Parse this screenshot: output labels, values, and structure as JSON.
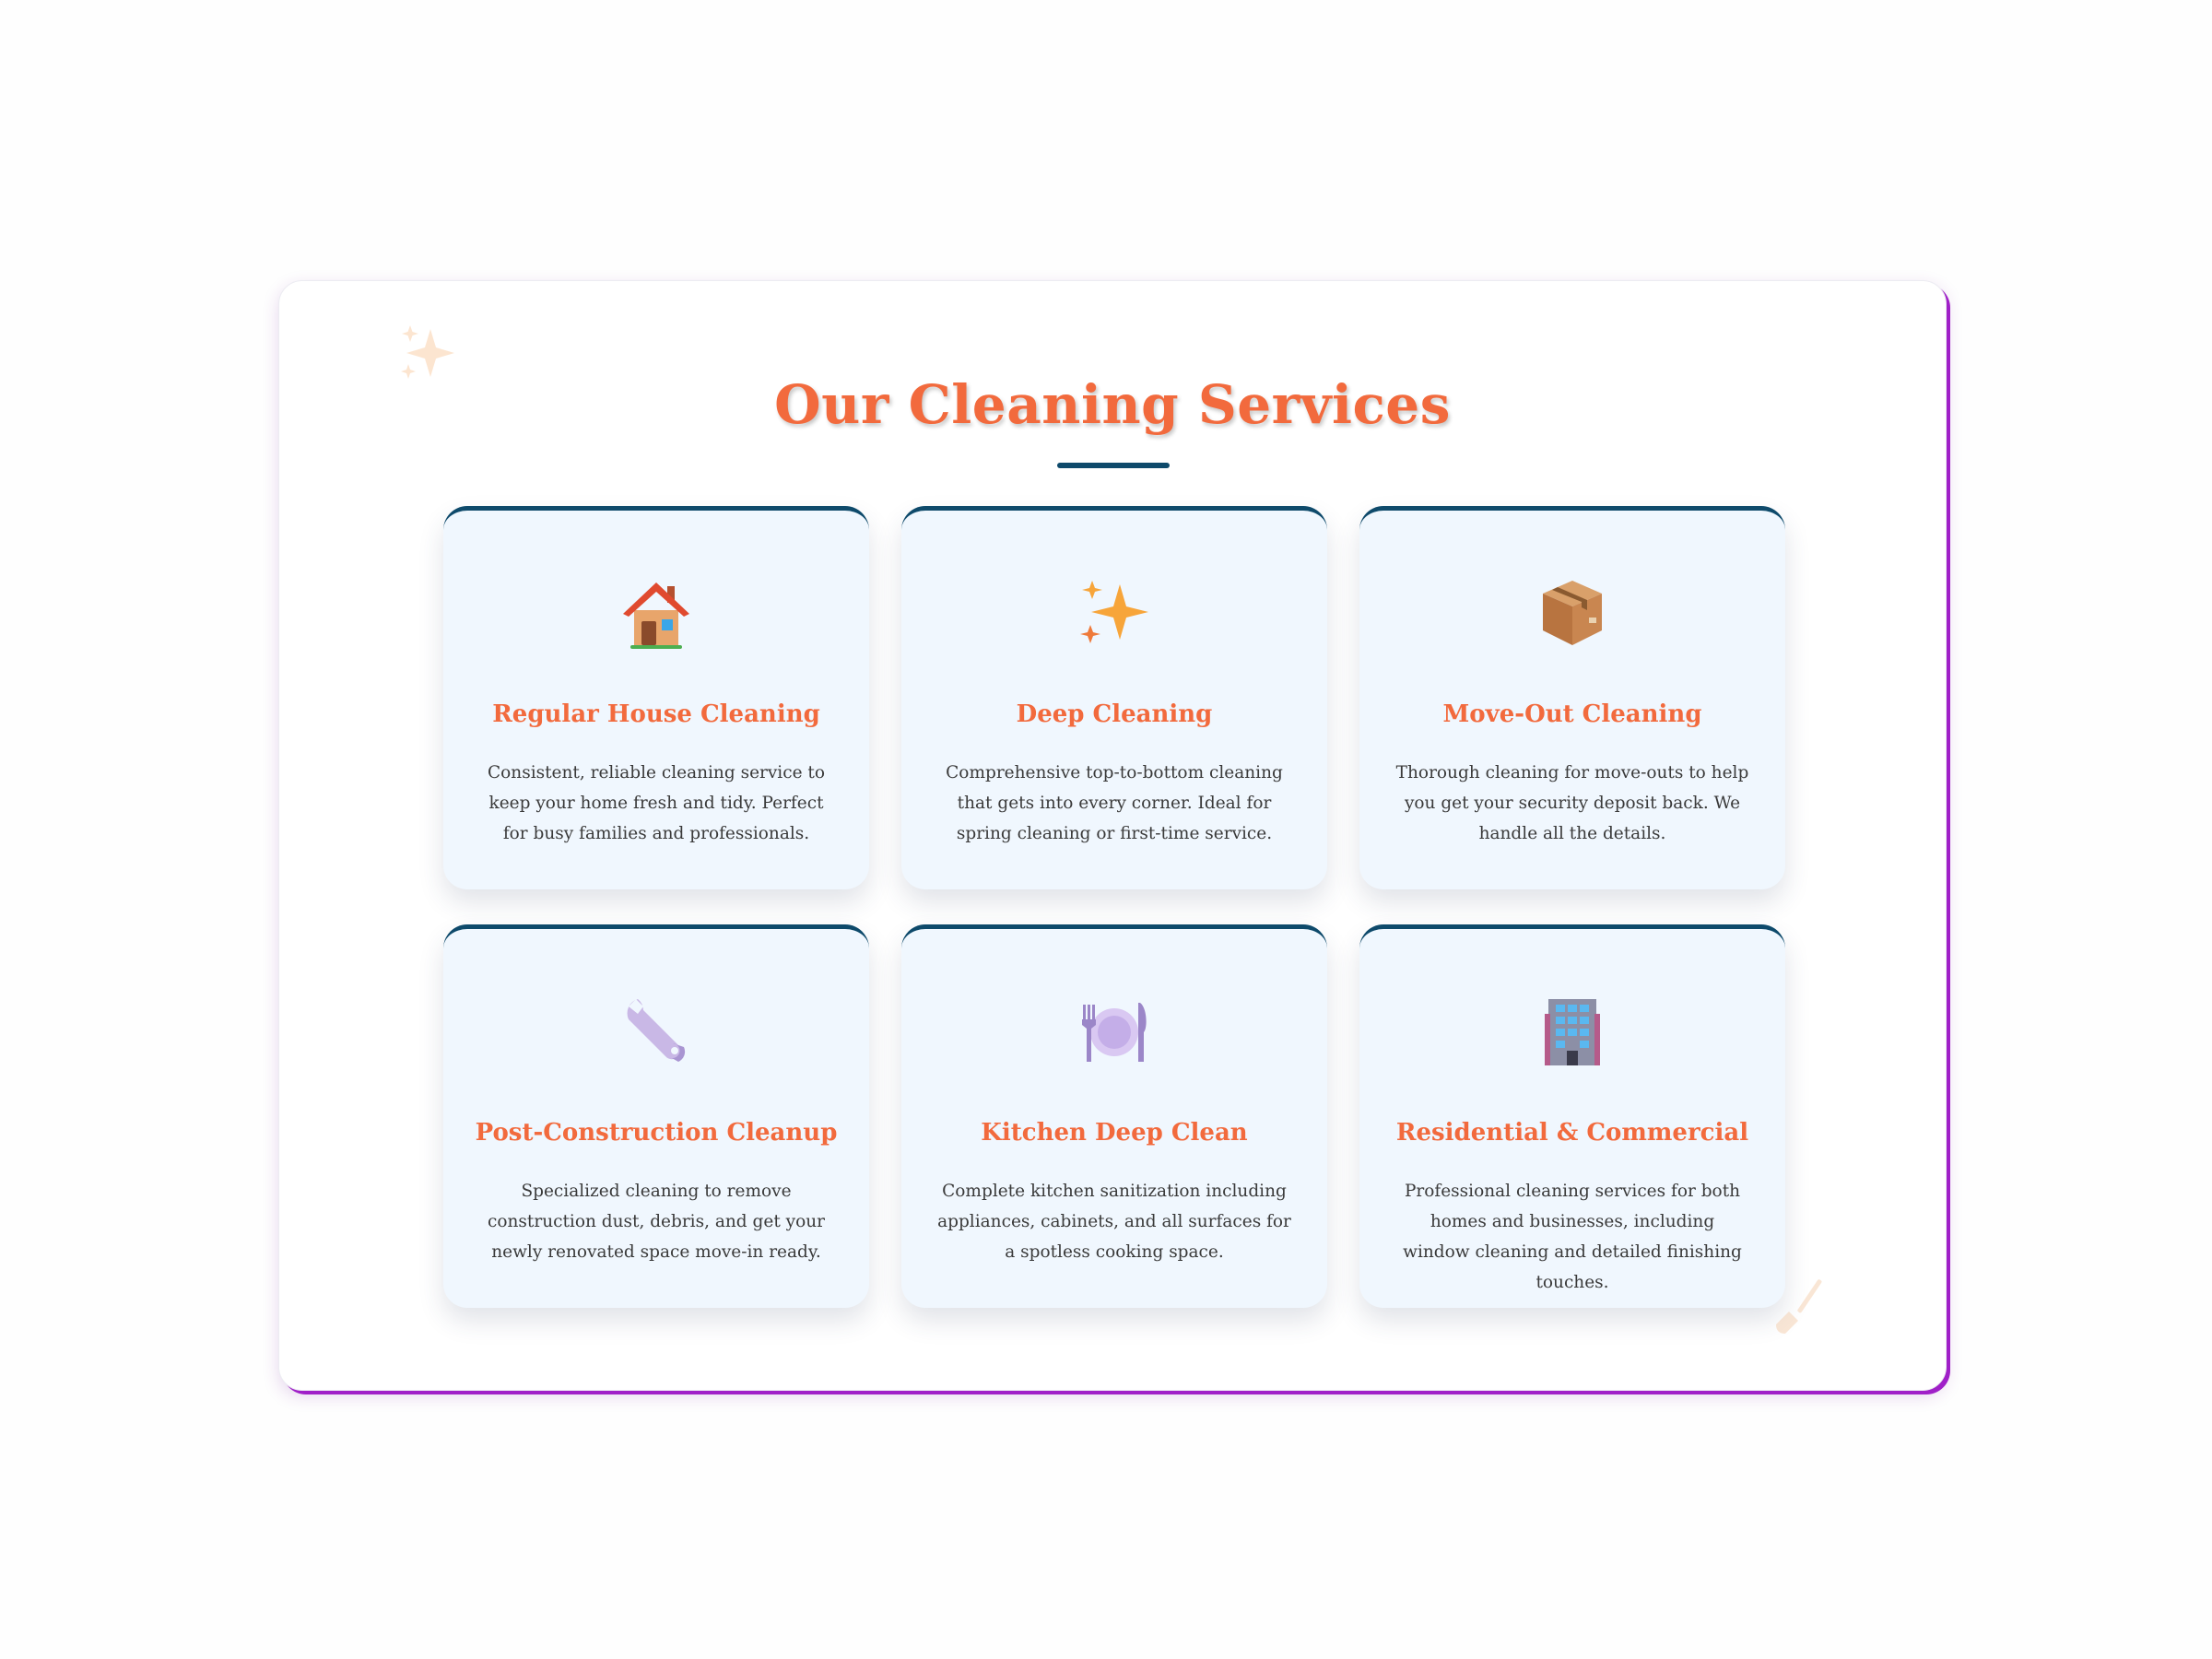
{
  "section": {
    "title": "Our Cleaning Services"
  },
  "services": [
    {
      "icon": "house-icon",
      "title": "Regular House Cleaning",
      "description": "Consistent, reliable cleaning service to keep your home fresh and tidy. Perfect for busy families and professionals."
    },
    {
      "icon": "sparkles-icon",
      "title": "Deep Cleaning",
      "description": "Comprehensive top-to-bottom cleaning that gets into every corner. Ideal for spring cleaning or first-time service."
    },
    {
      "icon": "package-icon",
      "title": "Move-Out Cleaning",
      "description": "Thorough cleaning for move-outs to help you get your security deposit back. We handle all the details."
    },
    {
      "icon": "wrench-icon",
      "title": "Post-Construction Cleanup",
      "description": "Specialized cleaning to remove construction dust, debris, and get your newly renovated space move-in ready."
    },
    {
      "icon": "plate-cutlery-icon",
      "title": "Kitchen Deep Clean",
      "description": "Complete kitchen sanitization including appliances, cabinets, and all surfaces for a spotless cooking space."
    },
    {
      "icon": "office-building-icon",
      "title": "Residential & Commercial",
      "description": "Professional cleaning services for both homes and businesses, including window cleaning and detailed finishing touches."
    }
  ],
  "colors": {
    "accent": "#f26a3d",
    "navy": "#0e4a6b",
    "card_bg": "#f0f7fe",
    "panel_shadow": "#a020c8"
  }
}
